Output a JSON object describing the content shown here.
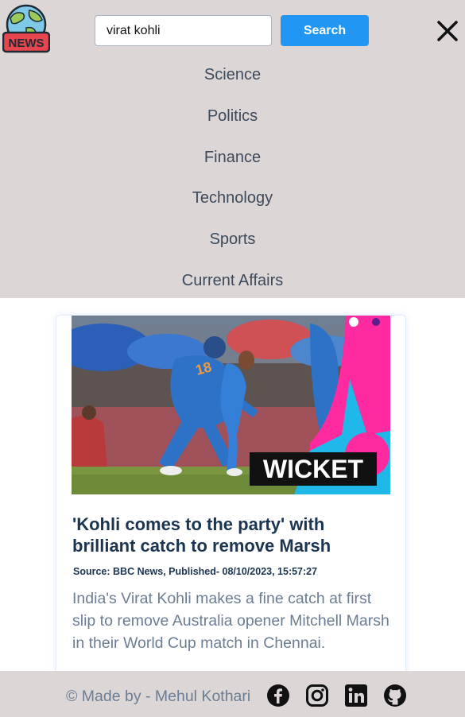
{
  "header": {
    "logo_text": "NEWS",
    "search": {
      "value": "virat kohli",
      "placeholder": ""
    },
    "search_label": "Search"
  },
  "menu": {
    "items": [
      {
        "label": "Science"
      },
      {
        "label": "Politics"
      },
      {
        "label": "Finance"
      },
      {
        "label": "Technology"
      },
      {
        "label": "Sports"
      },
      {
        "label": "Current Affairs"
      }
    ]
  },
  "article": {
    "image_badge": "WICKET",
    "jersey_number": "18",
    "title": "'Kohli comes to the party' with brilliant catch to remove Marsh",
    "source": "Source: BBC News, Published- 08/10/2023, 15:57:27",
    "description": "India's Virat Kohli makes a fine catch at first slip to remove Australia opener Mitchell Marsh in their World Cup match in Chennai."
  },
  "footer": {
    "text": "© Made by - Mehul Kothari",
    "social": [
      "facebook-icon",
      "instagram-icon",
      "linkedin-icon",
      "github-icon"
    ]
  },
  "colors": {
    "header_bg": "#dcd6d6",
    "accent": "#2196f3",
    "title": "#1b3550",
    "muted": "#6b7d94"
  }
}
